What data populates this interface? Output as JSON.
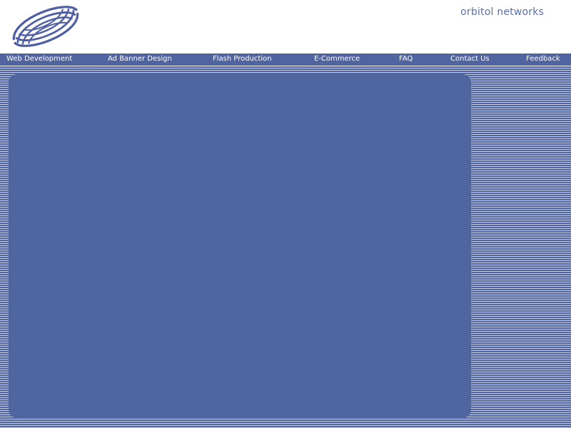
{
  "brand": {
    "name": "orbitol networks",
    "logo_icon": "spiral-swirl-icon"
  },
  "nav": {
    "items": [
      {
        "label": "Web Development"
      },
      {
        "label": "Ad Banner Design"
      },
      {
        "label": "Flash Production"
      },
      {
        "label": "E-Commerce"
      },
      {
        "label": "FAQ"
      },
      {
        "label": "Contact Us"
      },
      {
        "label": "Feedback"
      }
    ]
  },
  "colors": {
    "nav_background": "#5064a0",
    "brand_text": "#5b6fae",
    "panel": "#4f65a0",
    "stripe_light": "#c7cfe4"
  }
}
